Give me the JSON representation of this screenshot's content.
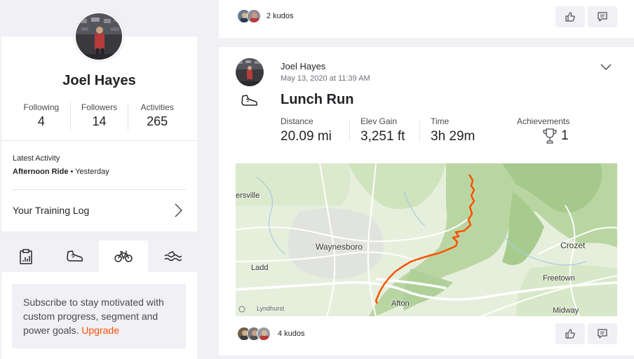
{
  "profile": {
    "name": "Joel Hayes",
    "stats": [
      {
        "label": "Following",
        "value": "4"
      },
      {
        "label": "Followers",
        "value": "14"
      },
      {
        "label": "Activities",
        "value": "265"
      }
    ],
    "latest_activity_label": "Latest Activity",
    "latest_activity_name": "Afternoon Ride",
    "latest_activity_when": " • Yesterday",
    "training_log": "Your Training Log"
  },
  "sport_tabs": [
    "clipboard-icon",
    "shoe-icon",
    "bike-icon",
    "swim-icon"
  ],
  "subscribe": {
    "text": "Subscribe to stay motivated with custom progress, segment and power goals. ",
    "link": "Upgrade"
  },
  "feed_top": {
    "kudos": "2 kudos"
  },
  "activity": {
    "athlete": "Joel Hayes",
    "date": "May 13, 2020 at 11:39 AM",
    "title": "Lunch Run",
    "metrics": [
      {
        "label": "Distance",
        "value": "20.09 mi"
      },
      {
        "label": "Elev Gain",
        "value": "3,251 ft"
      },
      {
        "label": "Time",
        "value": "3h 29m"
      }
    ],
    "achievements_label": "Achievements",
    "achievements_value": "1",
    "kudos": "4 kudos",
    "map_labels": {
      "waynesboro": "Waynesboro",
      "ersville": "ersville",
      "ladd": "Ladd",
      "afton": "Afton",
      "lyndhurst": "Lyndhurst",
      "crozet": "Crozet",
      "freetown": "Freetown",
      "midway": "Midway"
    }
  },
  "colors": {
    "accent": "#fc5200",
    "route": "#fc5200"
  }
}
